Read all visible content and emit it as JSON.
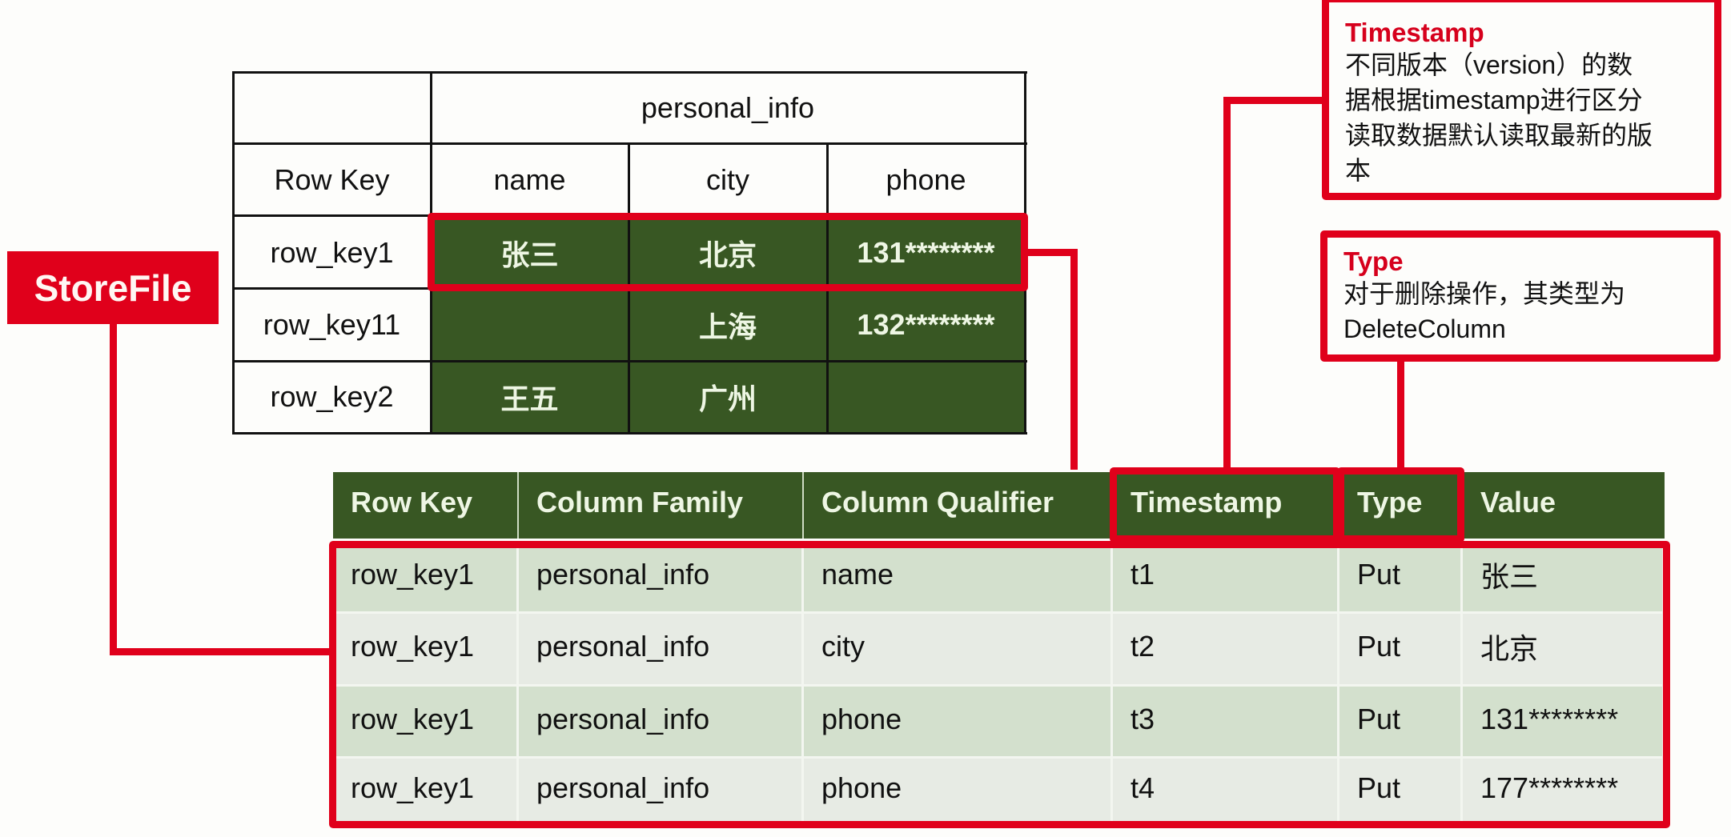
{
  "logical_table": {
    "family_header": "personal_info",
    "row_key_header": "Row Key",
    "columns": [
      "name",
      "city",
      "phone"
    ],
    "rows": [
      {
        "row_key": "row_key1",
        "cells": [
          "张三",
          "北京",
          "131********"
        ]
      },
      {
        "row_key": "row_key11",
        "cells": [
          "",
          "上海",
          "132********"
        ]
      },
      {
        "row_key": "row_key2",
        "cells": [
          "王五",
          "广州",
          ""
        ]
      }
    ]
  },
  "storefile_label": "StoreFile",
  "kv_table": {
    "headers": [
      "Row Key",
      "Column Family",
      "Column Qualifier",
      "Timestamp",
      "Type",
      "Value"
    ],
    "rows": [
      [
        "row_key1",
        "personal_info",
        "name",
        "t1",
        "Put",
        "张三"
      ],
      [
        "row_key1",
        "personal_info",
        "city",
        "t2",
        "Put",
        "北京"
      ],
      [
        "row_key1",
        "personal_info",
        "phone",
        "t3",
        "Put",
        "131********"
      ],
      [
        "row_key1",
        "personal_info",
        "phone",
        "t4",
        "Put",
        "177********"
      ]
    ]
  },
  "callouts": {
    "timestamp": {
      "title": "Timestamp",
      "lines": [
        "不同版本（version）的数",
        "据根据timestamp进行区分",
        "读取数据默认读取最新的版",
        "本"
      ]
    },
    "type": {
      "title": "Type",
      "lines": [
        "对于删除操作，其类型为",
        "DeleteColumn"
      ]
    }
  },
  "colors": {
    "accent_red": "#e0001b",
    "header_green": "#385723",
    "row_light_green": "#d3e0cd",
    "row_pale": "#e7ebe4"
  }
}
